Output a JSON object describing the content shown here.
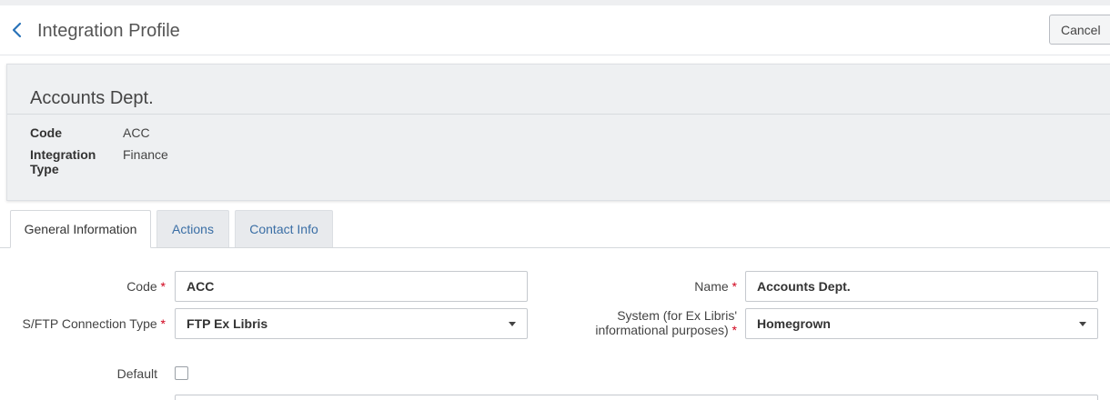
{
  "header": {
    "title": "Integration Profile",
    "cancel_label": "Cancel"
  },
  "summary": {
    "title": "Accounts Dept.",
    "fields": [
      {
        "label": "Code",
        "value": "ACC"
      },
      {
        "label": "Integration Type",
        "value": "Finance"
      }
    ]
  },
  "tabs": [
    {
      "label": "General Information",
      "active": true
    },
    {
      "label": "Actions",
      "active": false
    },
    {
      "label": "Contact Info",
      "active": false
    }
  ],
  "form": {
    "code": {
      "label": "Code",
      "value": "ACC",
      "required": true
    },
    "name": {
      "label": "Name",
      "value": "Accounts Dept.",
      "required": true
    },
    "connection_type": {
      "label": "S/FTP Connection Type",
      "value": "FTP Ex Libris",
      "required": true
    },
    "system": {
      "label": "System (for Ex Libris' informational purposes)",
      "value": "Homegrown",
      "required": true
    },
    "default": {
      "label": "Default",
      "checked": false
    }
  },
  "icons": {
    "back": "chevron-left-icon",
    "dropdown": "caret-down-icon"
  },
  "colors": {
    "accent": "#3a6ea5",
    "required": "#d0021b",
    "summary_bg": "#eef0f2"
  }
}
